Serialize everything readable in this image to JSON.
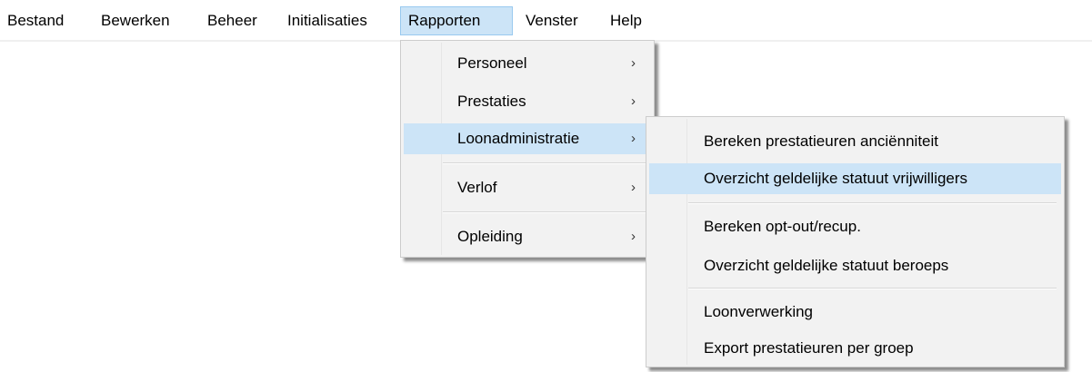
{
  "menubar": {
    "items": [
      {
        "label": "Bestand"
      },
      {
        "label": "Bewerken"
      },
      {
        "label": "Beheer"
      },
      {
        "label": "Initialisaties"
      },
      {
        "label": "Rapporten"
      },
      {
        "label": "Venster"
      },
      {
        "label": "Help"
      }
    ],
    "active": "Rapporten"
  },
  "rapporten_menu": {
    "items": [
      {
        "label": "Personeel",
        "submenu": true
      },
      {
        "label": "Prestaties",
        "submenu": true
      },
      {
        "label": "Loonadministratie",
        "submenu": true,
        "highlighted": true
      },
      {
        "label": "Verlof",
        "submenu": true
      },
      {
        "label": "Opleiding",
        "submenu": true
      }
    ]
  },
  "loonadministratie_menu": {
    "items": [
      {
        "label": "Bereken prestatieuren anciënniteit"
      },
      {
        "label": "Overzicht geldelijke statuut vrijwilligers",
        "highlighted": true
      },
      {
        "label": "Bereken opt-out/recup."
      },
      {
        "label": "Overzicht geldelijke statuut beroeps"
      },
      {
        "label": "Loonverwerking"
      },
      {
        "label": "Export prestatieuren per groep"
      }
    ]
  },
  "icons": {
    "submenu_arrow": "chevron-right-icon"
  },
  "colors": {
    "highlight": "#cce4f7",
    "highlight_border": "#99c9ef",
    "menu_bg": "#f2f2f2"
  }
}
